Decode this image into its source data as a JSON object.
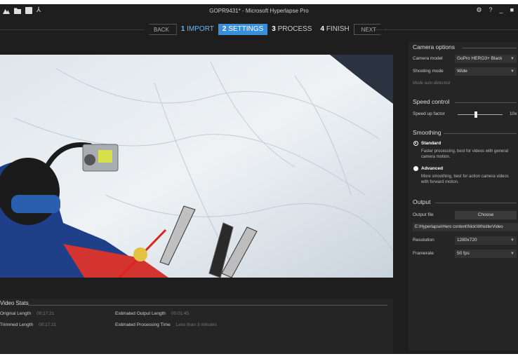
{
  "window": {
    "title": "GOPR9431* - Microsoft Hyperlapse Pro",
    "controls": {
      "settings": "⚙",
      "help": "?",
      "minimize": "_",
      "close": "■"
    }
  },
  "toolbar": {
    "icons": [
      "image-icon",
      "folder-icon",
      "save-icon",
      "pin-icon"
    ]
  },
  "steps": {
    "back": "BACK",
    "next": "NEXT",
    "items": [
      {
        "num": "1",
        "label": "IMPORT",
        "state": "done"
      },
      {
        "num": "2",
        "label": "SETTINGS",
        "state": "active"
      },
      {
        "num": "3",
        "label": "PROCESS",
        "state": "pending"
      },
      {
        "num": "4",
        "label": "FINISH",
        "state": "pending"
      }
    ]
  },
  "video_stats": {
    "title": "Video Stats",
    "original_length_label": "Original Length",
    "original_length_value": "00:17:21",
    "trimmed_length_label": "Trimmed Length",
    "trimmed_length_value": "00:17:21",
    "estimated_output_label": "Estimated Output Length",
    "estimated_output_value": "00:01:45",
    "estimated_processing_label": "Estimated Processing Time",
    "estimated_processing_value": "Less than 3 minutes"
  },
  "camera_options": {
    "title": "Camera options",
    "model_label": "Camera model",
    "model_value": "GoPro HERO3+ Black",
    "mode_label": "Shooting mode",
    "mode_value": "Wide",
    "note": "Mode auto detected"
  },
  "speed_control": {
    "title": "Speed control",
    "label": "Speed up factor",
    "value": "10x",
    "fraction": 0.4
  },
  "smoothing": {
    "title": "Smoothing",
    "options": [
      {
        "label": "Standard",
        "desc": "Faster processing, best for videos with general camera motion.",
        "selected": true
      },
      {
        "label": "Advanced",
        "desc": "More smoothing, best for action camera videos with forward motion.",
        "selected": false
      }
    ]
  },
  "output": {
    "title": "Output",
    "file_label": "Output file",
    "choose_label": "Choose",
    "path": "E:\\Hyperlapse\\Hero content\\Nick\\WhistlerVideo",
    "resolution_label": "Resolution",
    "resolution_value": "1280x720",
    "framerate_label": "Framerate",
    "framerate_value": "50 fps"
  },
  "colors": {
    "accent": "#3b8ed8",
    "background": "#1e1e1e",
    "panel": "#252525"
  }
}
